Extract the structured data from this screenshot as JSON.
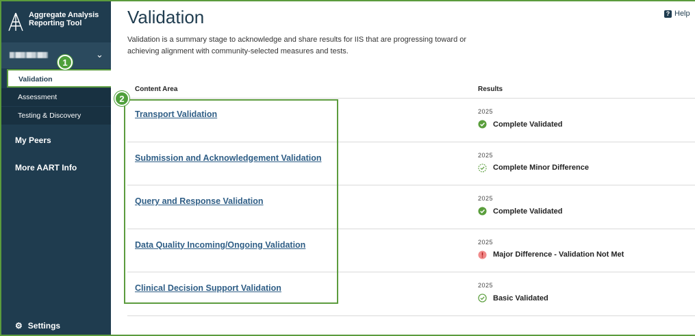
{
  "app": {
    "title_line1": "Aggregate Analysis",
    "title_line2": "Reporting Tool"
  },
  "sidebar": {
    "org_selector": {
      "chevron": "chevron-down-icon"
    },
    "active_item": "Validation",
    "sub_items": [
      {
        "label": "Assessment"
      },
      {
        "label": "Testing & Discovery"
      }
    ],
    "main_items": [
      {
        "label": "My Peers"
      },
      {
        "label": "More AART Info"
      }
    ],
    "settings_label": "Settings"
  },
  "callouts": {
    "one": "1",
    "two": "2"
  },
  "header": {
    "title": "Validation",
    "help_label": "Help"
  },
  "description": "Validation is a summary stage to acknowledge and share results for IIS that are progressing toward or achieving alignment with community-selected measures and tests.",
  "table": {
    "columns": {
      "area": "Content Area",
      "results": "Results"
    },
    "rows": [
      {
        "area": "Transport Validation",
        "year": "2025",
        "status": "Complete Validated",
        "icon": "check-filled-icon"
      },
      {
        "area": "Submission and Acknowledgement Validation",
        "year": "2025",
        "status": "Complete Minor Difference",
        "icon": "check-dashed-icon"
      },
      {
        "area": "Query and Response Validation",
        "year": "2025",
        "status": "Complete Validated",
        "icon": "check-filled-icon"
      },
      {
        "area": "Data Quality Incoming/Ongoing Validation",
        "year": "2025",
        "status": "Major Difference - Validation Not Met",
        "icon": "alert-icon"
      },
      {
        "area": "Clinical Decision Support Validation",
        "year": "2025",
        "status": "Basic Validated",
        "icon": "check-outline-icon"
      }
    ]
  },
  "colors": {
    "sidebar": "#1f3c4f",
    "highlight": "#5b9b3d",
    "link": "#2f5e86",
    "success": "#5a9e3c",
    "danger": "#e57373"
  }
}
